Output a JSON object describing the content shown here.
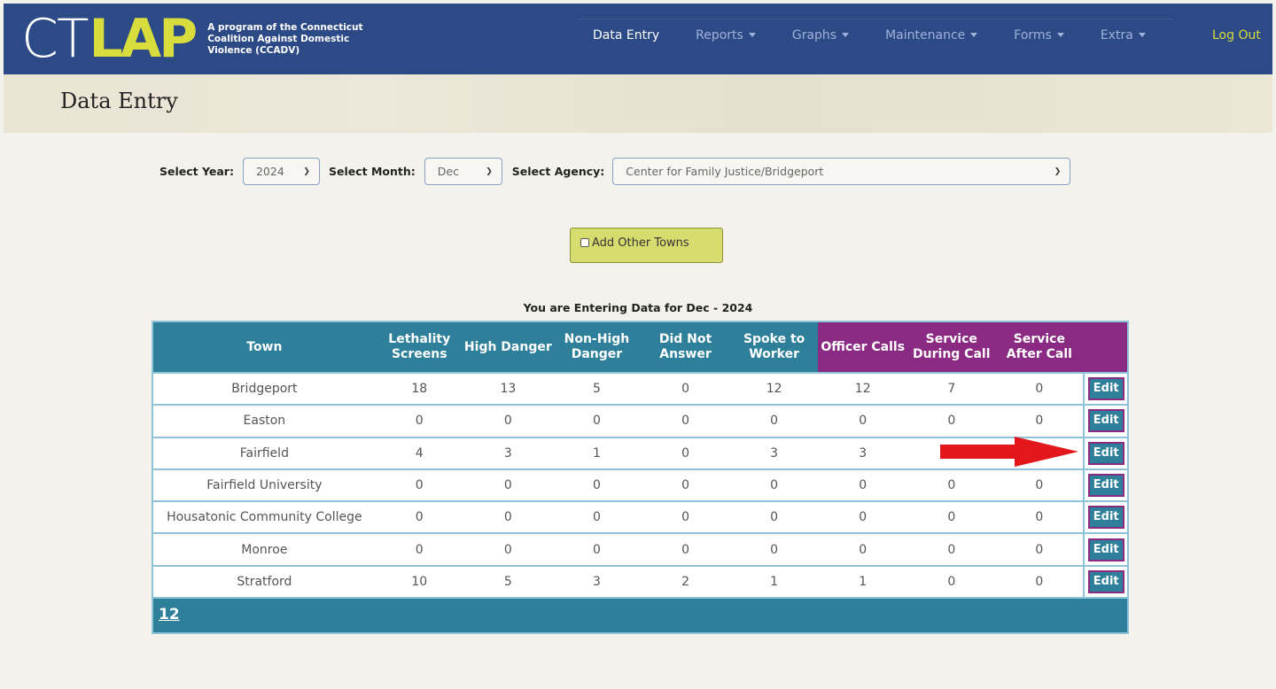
{
  "app": {
    "logo_ct": "CT",
    "logo_lap": "LAP",
    "logo_tagline": "A program of the Connecticut Coalition Against Domestic Violence (CCADV)"
  },
  "nav": {
    "items": [
      {
        "label": "Data Entry",
        "active": true,
        "dropdown": false
      },
      {
        "label": "Reports",
        "active": false,
        "dropdown": true
      },
      {
        "label": "Graphs",
        "active": false,
        "dropdown": true
      },
      {
        "label": "Maintenance",
        "active": false,
        "dropdown": true
      },
      {
        "label": "Forms",
        "active": false,
        "dropdown": true
      },
      {
        "label": "Extra",
        "active": false,
        "dropdown": true
      }
    ],
    "logout": "Log Out"
  },
  "page": {
    "title": "Data Entry"
  },
  "filters": {
    "year_label": "Select Year:",
    "year_value": "2024",
    "month_label": "Select Month:",
    "month_value": "Dec",
    "agency_label": "Select Agency:",
    "agency_value": "Center for Family Justice/Bridgeport"
  },
  "add_towns": {
    "label": "Add Other Towns",
    "checked": false
  },
  "caption": "You are Entering Data for Dec - 2024",
  "table": {
    "headers": [
      {
        "label": "Town",
        "color": "teal"
      },
      {
        "label": "Lethality Screens",
        "color": "teal"
      },
      {
        "label": "High Danger",
        "color": "teal"
      },
      {
        "label": "Non-High Danger",
        "color": "teal"
      },
      {
        "label": "Did Not Answer",
        "color": "teal"
      },
      {
        "label": "Spoke to Worker",
        "color": "teal"
      },
      {
        "label": "Officer Calls",
        "color": "purple"
      },
      {
        "label": "Service During Call",
        "color": "purple"
      },
      {
        "label": "Service After Call",
        "color": "purple"
      }
    ],
    "edit_label": "Edit",
    "rows": [
      {
        "town": "Bridgeport",
        "values": [
          "18",
          "13",
          "5",
          "0",
          "12",
          "12",
          "7",
          "0"
        ]
      },
      {
        "town": "Easton",
        "values": [
          "0",
          "0",
          "0",
          "0",
          "0",
          "0",
          "0",
          "0"
        ]
      },
      {
        "town": "Fairfield",
        "values": [
          "4",
          "3",
          "1",
          "0",
          "3",
          "3",
          "",
          ""
        ]
      },
      {
        "town": "Fairfield University",
        "values": [
          "0",
          "0",
          "0",
          "0",
          "0",
          "0",
          "0",
          "0"
        ]
      },
      {
        "town": "Housatonic Community College",
        "values": [
          "0",
          "0",
          "0",
          "0",
          "0",
          "0",
          "0",
          "0"
        ]
      },
      {
        "town": "Monroe",
        "values": [
          "0",
          "0",
          "0",
          "0",
          "0",
          "0",
          "0",
          "0"
        ]
      },
      {
        "town": "Stratford",
        "values": [
          "10",
          "5",
          "3",
          "2",
          "1",
          "1",
          "0",
          "0"
        ]
      }
    ],
    "pager": "12"
  },
  "colors": {
    "navbar": "#2c4a86",
    "logo_accent": "#d8dc3c",
    "teal": "#2e7f99",
    "purple": "#8b2a82",
    "arrow": "#e3161b"
  },
  "annotation": {
    "arrow_icon": "red-arrow-right-icon",
    "points_to_row": "Fairfield"
  }
}
